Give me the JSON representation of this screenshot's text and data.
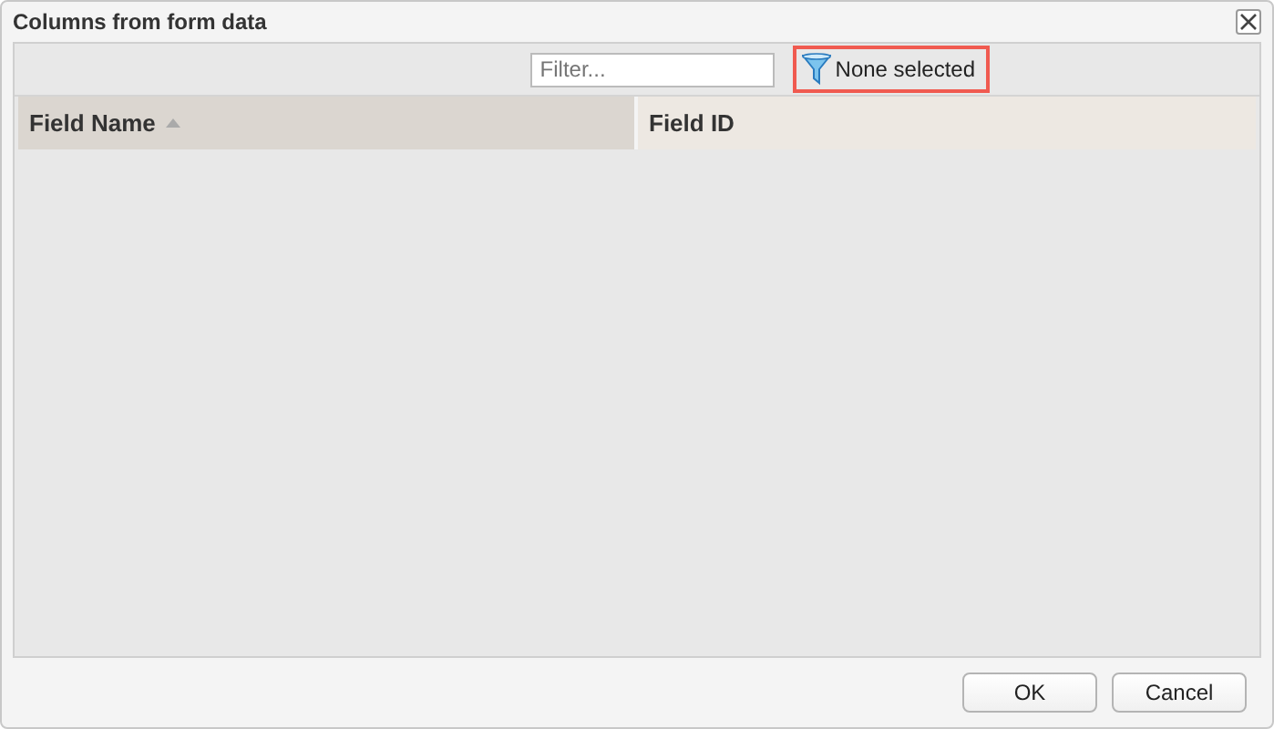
{
  "window": {
    "title": "Columns from form data"
  },
  "toolbar": {
    "filter": {
      "placeholder": "Filter..."
    },
    "selection_filter": {
      "label": "None selected",
      "highlighted": true
    }
  },
  "table": {
    "columns": [
      {
        "label": "Field Name",
        "sorted": true
      },
      {
        "label": "Field ID",
        "sorted": false
      }
    ]
  },
  "buttons": [
    "OK",
    "Cancel"
  ]
}
